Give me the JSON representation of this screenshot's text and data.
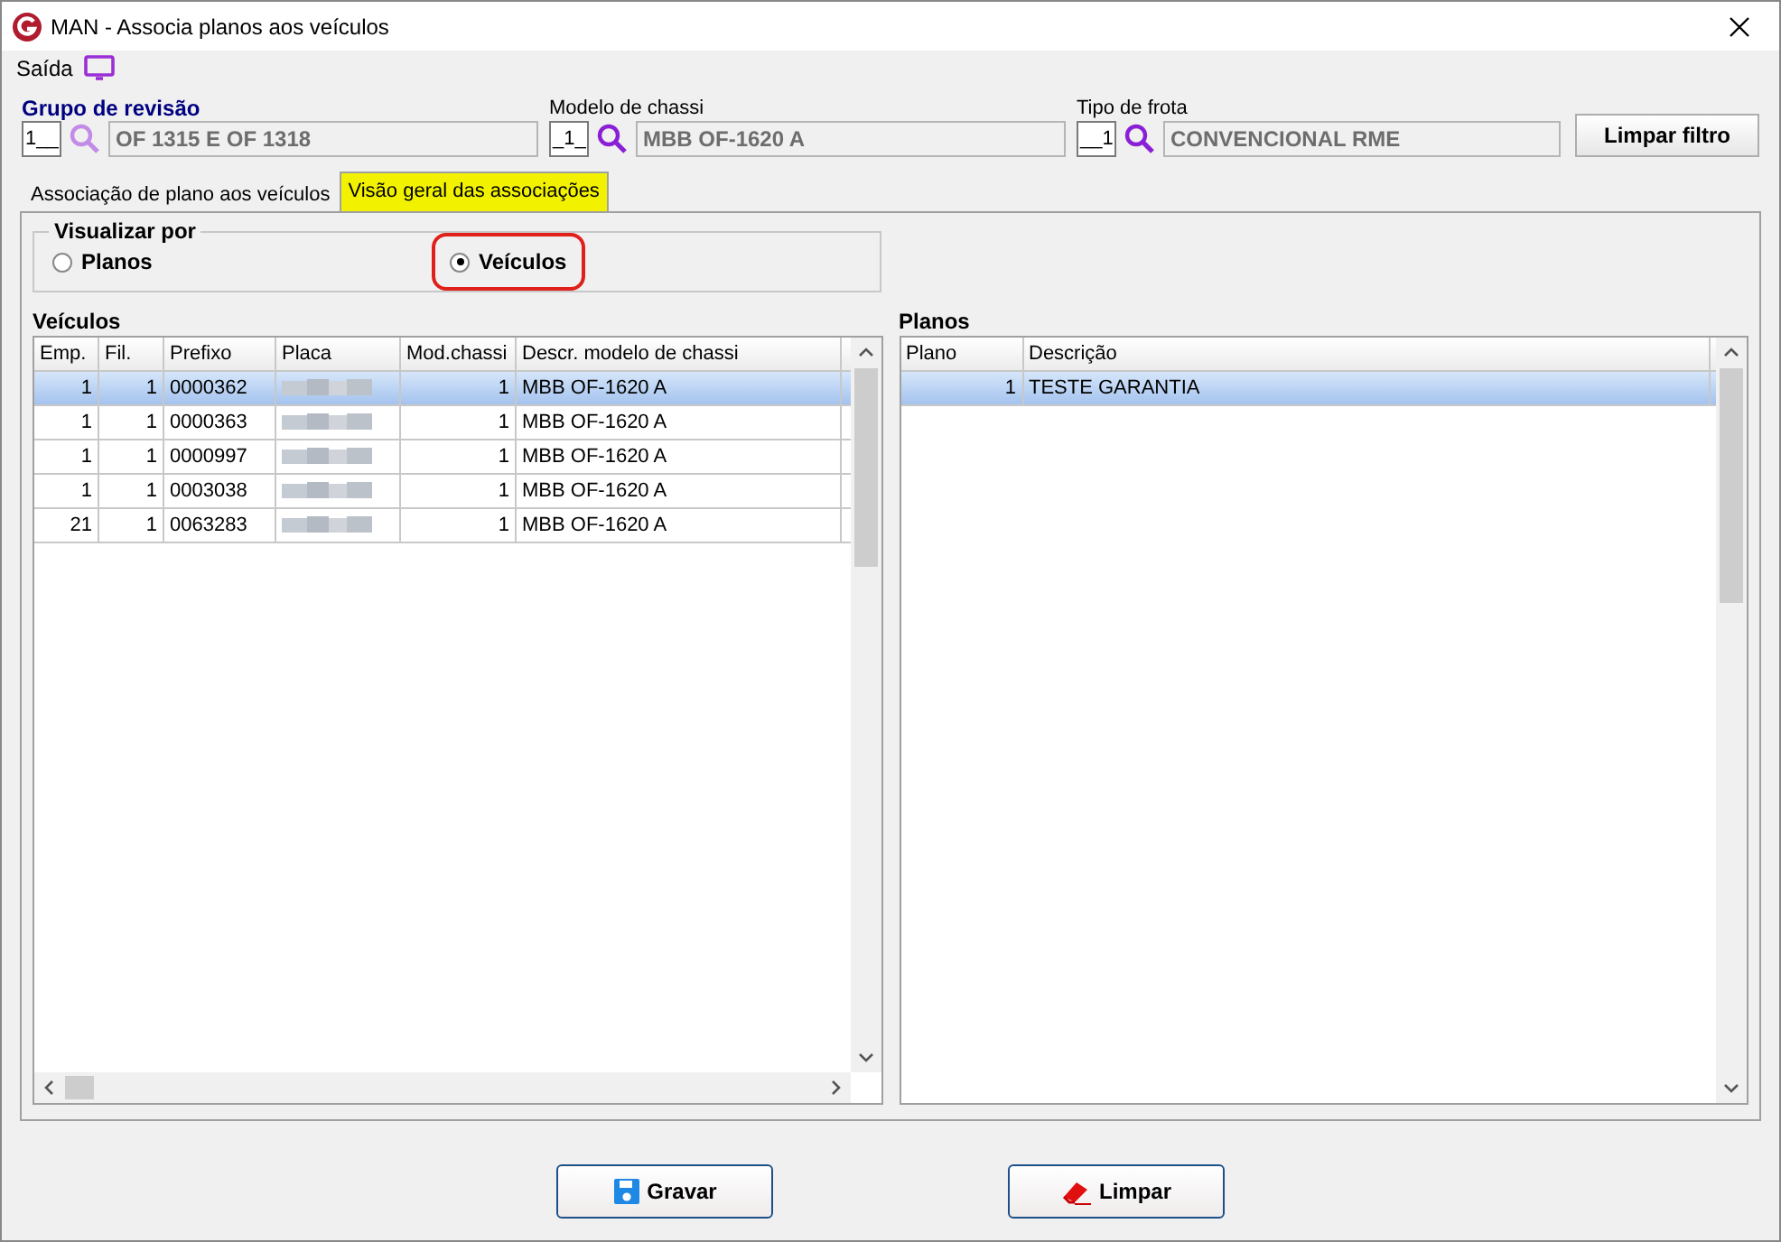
{
  "window": {
    "title": "MAN - Associa planos aos veículos"
  },
  "menu": {
    "label": "Saída"
  },
  "filters": [
    {
      "label": "Grupo de revisão",
      "highlighted": true,
      "code": "1__",
      "value": "OF 1315 E OF 1318"
    },
    {
      "label": "Modelo de chassi",
      "highlighted": false,
      "code": "_1_",
      "value": "MBB OF-1620 A"
    },
    {
      "label": "Tipo de frota",
      "highlighted": false,
      "code": "__1",
      "value": "CONVENCIONAL RME"
    }
  ],
  "clear_filter_button": "Limpar filtro",
  "tabs": [
    {
      "label": "Associação de plano aos veículos",
      "selected": false
    },
    {
      "label": "Visão geral das associações",
      "selected": true
    }
  ],
  "view_by": {
    "title": "Visualizar por",
    "options": [
      {
        "label": "Planos",
        "selected": false
      },
      {
        "label": "Veículos",
        "selected": true
      }
    ]
  },
  "vehicles": {
    "title": "Veículos",
    "columns": [
      "Emp.",
      "Fil.",
      "Prefixo",
      "Placa",
      "Mod.chassi",
      "Descr. modelo de chassi"
    ],
    "rows": [
      {
        "selected": true,
        "cells": [
          "1",
          "1",
          "0000362",
          "",
          "1",
          "MBB OF-1620 A"
        ]
      },
      {
        "selected": false,
        "cells": [
          "1",
          "1",
          "0000363",
          "",
          "1",
          "MBB OF-1620 A"
        ]
      },
      {
        "selected": false,
        "cells": [
          "1",
          "1",
          "0000997",
          "",
          "1",
          "MBB OF-1620 A"
        ]
      },
      {
        "selected": false,
        "cells": [
          "1",
          "1",
          "0003038",
          "",
          "1",
          "MBB OF-1620 A"
        ]
      },
      {
        "selected": false,
        "cells": [
          "21",
          "1",
          "0063283",
          "",
          "1",
          "MBB OF-1620 A"
        ]
      }
    ]
  },
  "plans": {
    "title": "Planos",
    "columns": [
      "Plano",
      "Descrição"
    ],
    "rows": [
      {
        "selected": true,
        "cells": [
          "1",
          "TESTE GARANTIA"
        ]
      }
    ]
  },
  "buttons": [
    {
      "kind": "save",
      "label": "Gravar"
    },
    {
      "kind": "clear",
      "label": "Limpar"
    }
  ]
}
